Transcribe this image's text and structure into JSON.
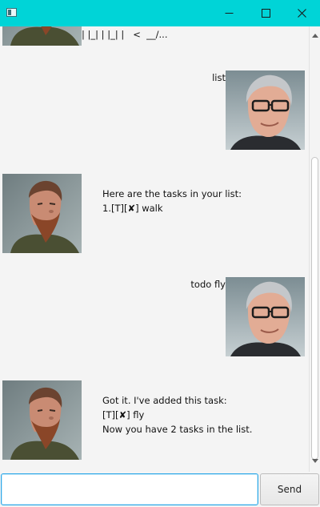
{
  "window": {
    "icons": {
      "app": "app-window-icon",
      "minimize": "minimize-icon",
      "maximize": "maximize-icon",
      "close": "close-icon"
    }
  },
  "dialog": {
    "partial_logo_text": "| |_| | |_| |   <  __/...",
    "messages": [
      {
        "sender": "user",
        "text": "list"
      },
      {
        "sender": "bot",
        "text": "Here are the tasks in your list:\n1.[T][✘] walk"
      },
      {
        "sender": "user",
        "text": "todo fly"
      },
      {
        "sender": "bot",
        "text": "Got it. I've added this task:\n[T][✘] fly\nNow you have 2 tasks in the list."
      }
    ]
  },
  "input": {
    "value": "",
    "placeholder": ""
  },
  "send_button": {
    "label": "Send"
  },
  "colors": {
    "titlebar": "#00d4d7",
    "background": "#f4f4f4",
    "input_focus_border": "#2ea8e8"
  }
}
